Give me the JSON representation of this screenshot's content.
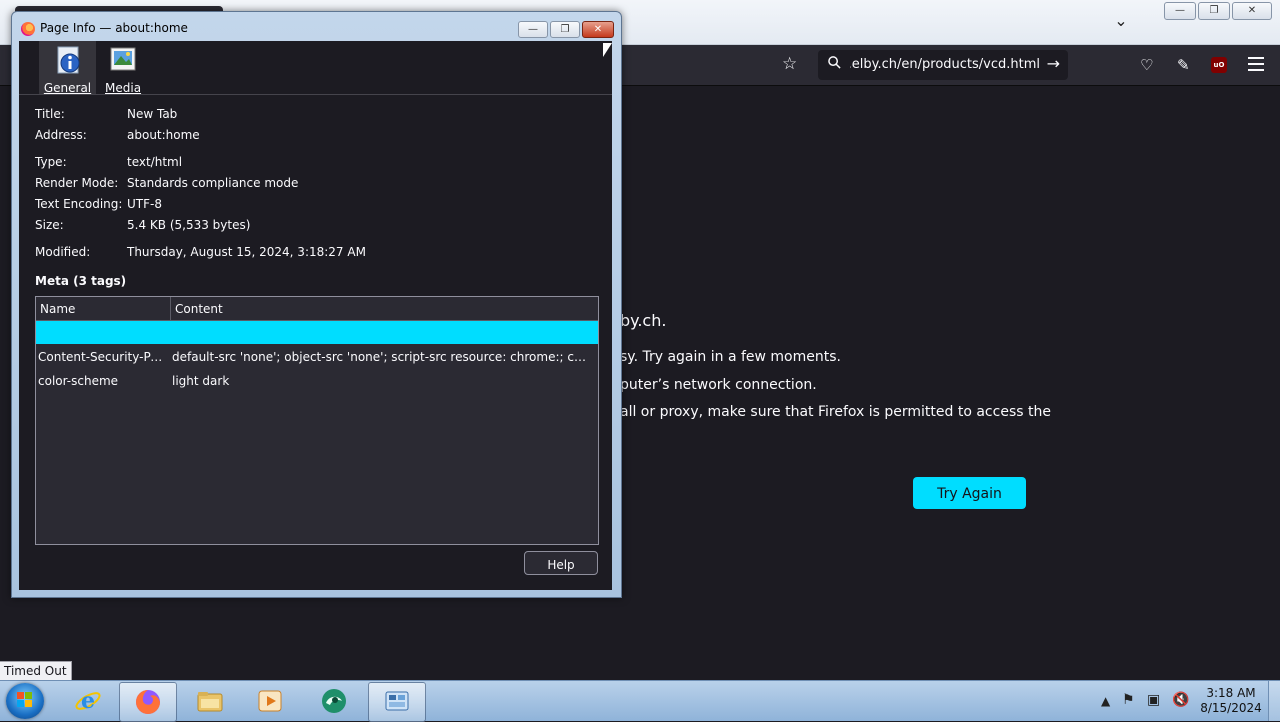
{
  "browser": {
    "url_text": "w.elby.ch/en/products/vcd.html",
    "error": {
      "host_fragment": "by.ch.",
      "line1": "sy. Try again in a few moments.",
      "line2": "puter’s network connection.",
      "line3": "all or proxy, make sure that Firefox is permitted to access the",
      "try_again_label": "Try Again"
    },
    "status_text": "Timed Out"
  },
  "dialog": {
    "title": "Page Info — about:home",
    "tabs": [
      {
        "label": "General",
        "icon": "info-icon",
        "selected": true
      },
      {
        "label": "Media",
        "icon": "media-icon",
        "selected": false
      }
    ],
    "info": [
      {
        "key": "Title:",
        "value": "New Tab"
      },
      {
        "key": "Address:",
        "value": "about:home"
      },
      {
        "key": "Type:",
        "value": "text/html"
      },
      {
        "key": "Render Mode:",
        "value": "Standards compliance mode"
      },
      {
        "key": "Text Encoding:",
        "value": "UTF-8"
      },
      {
        "key": "Size:",
        "value": "5.4 KB (5,533 bytes)"
      },
      {
        "key": "Modified:",
        "value": "Thursday, August 15, 2024, 3:18:27 AM"
      }
    ],
    "meta_heading": "Meta (3 tags)",
    "meta_columns": {
      "name": "Name",
      "content": "Content"
    },
    "meta_rows": [
      {
        "name": "",
        "content": "",
        "selected": true
      },
      {
        "name": "Content-Security-Polic...",
        "content": "default-src 'none'; object-src 'none'; script-src resource: chrome:; connect-src ..."
      },
      {
        "name": "color-scheme",
        "content": "light dark"
      }
    ],
    "help_label": "Help"
  },
  "taskbar": {
    "apps": [
      "internet-explorer",
      "firefox",
      "file-explorer",
      "media-player",
      "unknown-app",
      "control-panel"
    ],
    "clock": {
      "time": "3:18 AM",
      "date": "8/15/2024"
    }
  },
  "colors": {
    "accent": "#00ddff",
    "background": "#1c1b22",
    "toolbar": "#2b2a33"
  }
}
